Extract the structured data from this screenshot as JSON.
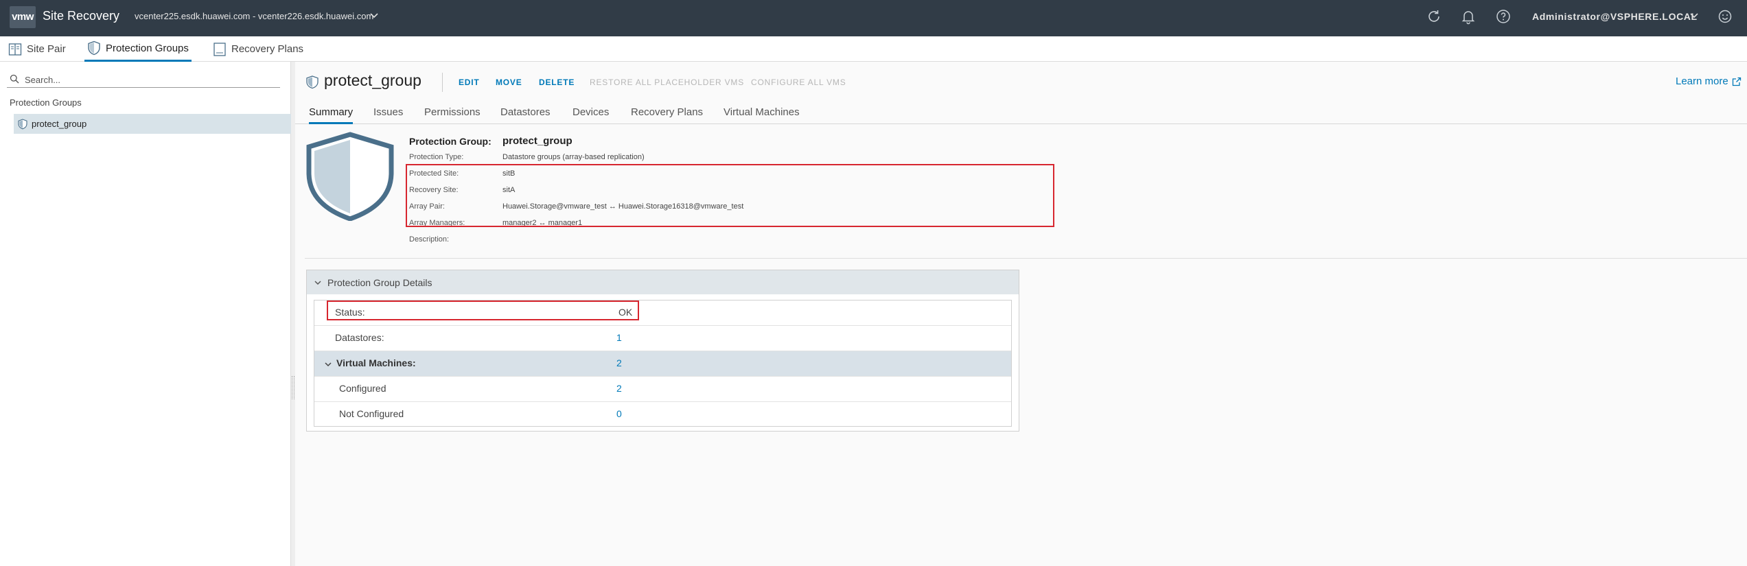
{
  "header": {
    "logo_text": "vmw",
    "app_title": "Site Recovery",
    "vcenter_pair": "vcenter225.esdk.huawei.com - vcenter226.esdk.huawei.com",
    "user": "Administrator@VSPHERE.LOCAL",
    "icons": [
      "refresh-icon",
      "bell-icon",
      "help-icon",
      "smiley-icon"
    ]
  },
  "top_tabs": [
    {
      "label": "Site Pair",
      "icon": "site-pair-icon",
      "active": false
    },
    {
      "label": "Protection Groups",
      "icon": "shield-icon",
      "active": true
    },
    {
      "label": "Recovery Plans",
      "icon": "plan-icon",
      "active": false
    }
  ],
  "sidebar": {
    "search_placeholder": "Search...",
    "heading": "Protection Groups",
    "items": [
      {
        "label": "protect_group",
        "icon": "shield-icon",
        "selected": true
      }
    ]
  },
  "main": {
    "title": "protect_group",
    "actions": [
      {
        "label": "EDIT",
        "enabled": true
      },
      {
        "label": "MOVE",
        "enabled": true
      },
      {
        "label": "DELETE",
        "enabled": true
      },
      {
        "label": "RESTORE ALL PLACEHOLDER VMS",
        "enabled": false
      },
      {
        "label": "CONFIGURE ALL VMS",
        "enabled": false
      }
    ],
    "learn_more": "Learn more",
    "tabs": [
      {
        "label": "Summary",
        "active": true
      },
      {
        "label": "Issues",
        "active": false
      },
      {
        "label": "Permissions",
        "active": false
      },
      {
        "label": "Datastores",
        "active": false
      },
      {
        "label": "Devices",
        "active": false
      },
      {
        "label": "Recovery Plans",
        "active": false
      },
      {
        "label": "Virtual Machines",
        "active": false
      }
    ],
    "summary": {
      "group_label": "Protection Group:",
      "group_value": "protect_group",
      "fields": [
        {
          "label": "Protection Type:",
          "value": "Datastore groups (array-based replication)"
        },
        {
          "label": "Protected Site:",
          "value": "sitB"
        },
        {
          "label": "Recovery Site:",
          "value": "sitA"
        },
        {
          "label": "Array Pair:",
          "value": "Huawei.Storage@vmware_test ↔ Huawei.Storage16318@vmware_test"
        },
        {
          "label": "Array Managers:",
          "value": "manager2 ↔ manager1"
        },
        {
          "label": "Description:",
          "value": ""
        }
      ]
    },
    "details": {
      "title": "Protection Group Details",
      "rows": [
        {
          "label": "Status:",
          "value": "OK"
        },
        {
          "label": "Datastores:",
          "value": "1"
        },
        {
          "label": "Virtual Machines:",
          "value": "2"
        },
        {
          "label": "Configured",
          "value": "2"
        },
        {
          "label": "Not Configured",
          "value": "0"
        }
      ]
    }
  },
  "colors": {
    "header_bg": "#313c47",
    "accent": "#0079b8",
    "highlight_box": "#d7262f",
    "selected_bg": "#d8e3e9"
  }
}
